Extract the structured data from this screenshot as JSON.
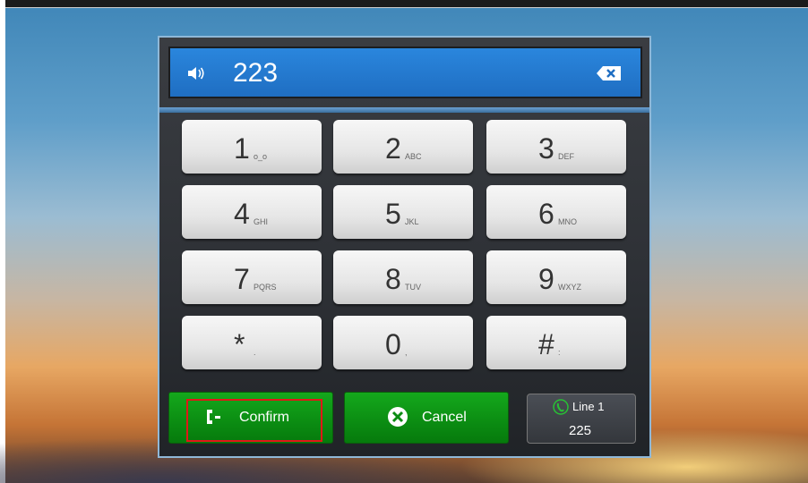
{
  "display": {
    "number": "223"
  },
  "keys": [
    {
      "digit": "1",
      "letters": "o_o"
    },
    {
      "digit": "2",
      "letters": "ABC"
    },
    {
      "digit": "3",
      "letters": "DEF"
    },
    {
      "digit": "4",
      "letters": "GHI"
    },
    {
      "digit": "5",
      "letters": "JKL"
    },
    {
      "digit": "6",
      "letters": "MNO"
    },
    {
      "digit": "7",
      "letters": "PQRS"
    },
    {
      "digit": "8",
      "letters": "TUV"
    },
    {
      "digit": "9",
      "letters": "WXYZ"
    },
    {
      "digit": "*",
      "letters": "."
    },
    {
      "digit": "0",
      "letters": ","
    },
    {
      "digit": "#",
      "letters": ":"
    }
  ],
  "actions": {
    "confirm": "Confirm",
    "cancel": "Cancel"
  },
  "line": {
    "label": "Line 1",
    "number": "225"
  },
  "colors": {
    "accent": "#1f6ec2",
    "confirm": "#0b8c12",
    "highlight": "#e01818"
  }
}
